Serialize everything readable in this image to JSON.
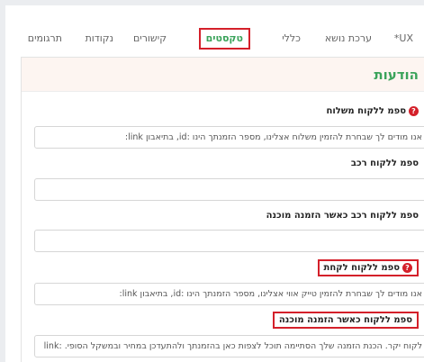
{
  "tabs": [
    {
      "label": "UX*",
      "active": false
    },
    {
      "label": "ערכת נושא",
      "active": false
    },
    {
      "label": "כללי",
      "active": false
    },
    {
      "label": "טקסטים",
      "active": true
    },
    {
      "label": "קישורים",
      "active": false
    },
    {
      "label": "נקודות",
      "active": false
    },
    {
      "label": "תרגומים",
      "active": false
    }
  ],
  "panel": {
    "title": "הודעות",
    "fields": [
      {
        "label": "ספמ ללקוח משלוח",
        "has_help": true,
        "highlighted": false,
        "value": "אנו מודים לך שבחרת להזמין משלוח אצלינו, מספר הזמנתך הינו :id, בתיאבון link:"
      },
      {
        "label": "ספמ ללקוח רכב",
        "has_help": false,
        "highlighted": false,
        "value": ""
      },
      {
        "label": "ספמ ללקוח רכב כאשר הזמנה מוכנה",
        "has_help": false,
        "highlighted": false,
        "value": ""
      },
      {
        "label": "ספמ ללקוח לקחת",
        "has_help": true,
        "highlighted": true,
        "value": "אנו מודים לך שבחרת להזמין טייק אווי אצלינו, מספר הזמנתך הינו :id, בתיאבון link:"
      },
      {
        "label": "ספמ ללקוח כאשר הזמנה מוכנה",
        "has_help": false,
        "highlighted": true,
        "value": "לקוח יקר. הכנת הזמנה שלך הסתיימה תוכל לצפות כאן בהזמנתך ולהתעדכן במחיר ובמשקל הסופי. :link"
      }
    ]
  },
  "help_icon": "question-circle-icon",
  "colors": {
    "accent": "#3aa35a",
    "highlight": "#d4202a",
    "panel_header_bg": "#fdf5f1"
  }
}
